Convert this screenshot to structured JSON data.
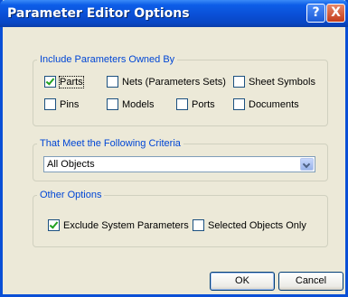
{
  "window": {
    "title": "Parameter Editor Options"
  },
  "title_buttons": {
    "help_label": "?",
    "close_label": "X"
  },
  "group_owned": {
    "legend": "Include Parameters Owned By",
    "options": [
      {
        "label": "Parts",
        "checked": true
      },
      {
        "label": "Nets (Parameters Sets)",
        "checked": false
      },
      {
        "label": "Sheet Symbols",
        "checked": false
      },
      {
        "label": "Pins",
        "checked": false
      },
      {
        "label": "Models",
        "checked": false
      },
      {
        "label": "Ports",
        "checked": false
      },
      {
        "label": "Documents",
        "checked": false
      }
    ]
  },
  "group_criteria": {
    "legend": "That Meet the Following Criteria",
    "selected": "All Objects"
  },
  "group_other": {
    "legend": "Other Options",
    "options": [
      {
        "label": "Exclude System Parameters",
        "checked": true
      },
      {
        "label": "Selected Objects Only",
        "checked": false
      }
    ]
  },
  "buttons": {
    "ok": "OK",
    "cancel": "Cancel"
  }
}
